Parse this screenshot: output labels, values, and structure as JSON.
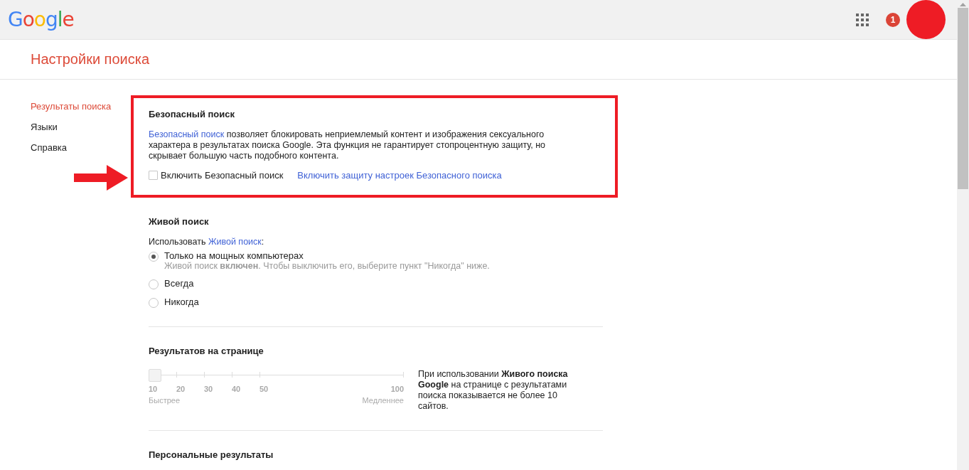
{
  "header": {
    "logo": "Google",
    "notification_count": "1"
  },
  "page_title": "Настройки поиска",
  "sidebar": {
    "items": [
      {
        "label": "Результаты поиска",
        "selected": true
      },
      {
        "label": "Языки",
        "selected": false
      },
      {
        "label": "Справка",
        "selected": false
      }
    ]
  },
  "safe_search": {
    "title": "Безопасный поиск",
    "description_link": "Безопасный поиск",
    "description": "позволяет блокировать неприемлемый контент и изображения сексуального характера в результатах поиска Google. Эта функция не гарантирует стопроцентную защиту, но скрывает большую часть подобного контента.",
    "checkbox": {
      "label": "Включить Безопасный поиск",
      "checked": false
    },
    "lock_link": "Включить защиту настроек Безопасного поиска"
  },
  "instant": {
    "title": "Живой поиск",
    "intro": "Использовать",
    "intro_link": "Живой поиск",
    "intro_suffix": ":",
    "options": [
      {
        "label": "Только на мощных компьютерах",
        "selected": true,
        "note": "Живой поиск **включен**. Чтобы выключить его, выберите пункт \"Никогда\" ниже."
      },
      {
        "label": "Всегда",
        "selected": false
      },
      {
        "label": "Никогда",
        "selected": false
      }
    ]
  },
  "results": {
    "title": "Результатов на странице",
    "slider": {
      "level": 0,
      "ticks": [
        "10",
        "20",
        "30",
        "40",
        "50",
        "100"
      ],
      "fast_label": "Быстрее",
      "slow_label": "Медленнее"
    },
    "note": "При использовании **Живого поиска Google** на странице с результатами поиска показывается не более 10 сайтов."
  },
  "personal": {
    "title": "Персональные результаты"
  }
}
